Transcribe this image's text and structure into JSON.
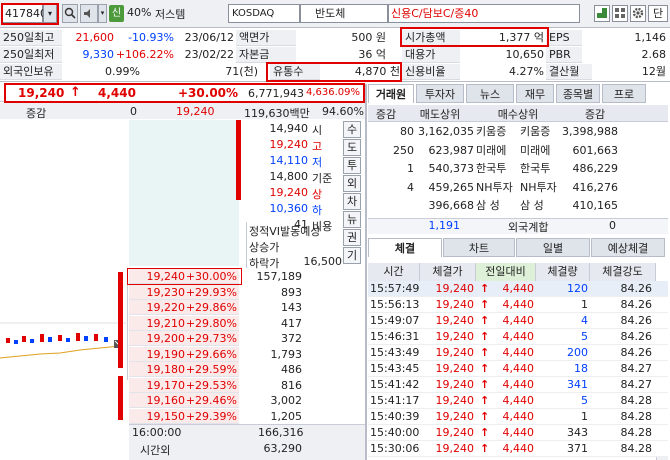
{
  "toolbar": {
    "code": "417840",
    "drop": "▾",
    "margin_rate": "40%",
    "stock_name": "저스템",
    "market": "KOSDAQ",
    "sector": "반도체",
    "tags": "신용C/담보C/증40",
    "credit_badge": "신",
    "btn_dan": "단"
  },
  "info": {
    "r1": {
      "l1": "250일최고",
      "v1": "21,600",
      "p1": "-10.93%",
      "d1": "23/06/12",
      "l2": "액면가",
      "v2": "500 원",
      "l3": "시가총액",
      "v3": "1,377 억",
      "l4": "EPS",
      "v4": "1,146"
    },
    "r2": {
      "l1": "250일최저",
      "v1": "9,330",
      "p1": "+106.22%",
      "d1": "23/02/22",
      "l2": "자본금",
      "v2": "36 억",
      "l3": "대용가",
      "v3": "10,650",
      "l4": "PBR",
      "v4": "2.68"
    },
    "r3": {
      "l1": "외국인보유",
      "v1": "0.99%",
      "v1b": "71(천)",
      "l3": "유통수",
      "v3": "4,870 천",
      "l4": "신용비율",
      "v4": "4.27%",
      "l5": "결산월",
      "v5": "12월"
    }
  },
  "price": {
    "current": "19,240",
    "arrow": "↑",
    "change": "4,440",
    "pct": "+30.00%",
    "volume": "6,771,943",
    "extra": "4,636.09%"
  },
  "chg": {
    "label": "증감",
    "v1": "0",
    "v2": "19,240",
    "v3": "119,630백만",
    "v4": "94.60%"
  },
  "summary": [
    {
      "price": "14,940",
      "label": "시"
    },
    {
      "price": "19,240",
      "label": "고"
    },
    {
      "price": "14,110",
      "label": "저"
    },
    {
      "price": "14,800",
      "label": "기준"
    },
    {
      "price": "19,240",
      "label": "상"
    },
    {
      "price": "10,360",
      "label": "하"
    },
    {
      "price": "41",
      "label": "비용"
    }
  ],
  "vi": {
    "line1": "정적VI발동예상",
    "line2": "상승가",
    "line3": "하락가",
    "val3": "16,500"
  },
  "side_buttons": [
    "수",
    "도",
    "투",
    "외",
    "차",
    "뉴",
    "권",
    "기"
  ],
  "orderbook": [
    {
      "price": "19,240",
      "pct": "+30.00%",
      "qty": "157,189"
    },
    {
      "price": "19,230",
      "pct": "+29.93%",
      "qty": "893"
    },
    {
      "price": "19,220",
      "pct": "+29.86%",
      "qty": "143"
    },
    {
      "price": "19,210",
      "pct": "+29.80%",
      "qty": "417"
    },
    {
      "price": "19,200",
      "pct": "+29.73%",
      "qty": "372"
    },
    {
      "price": "19,190",
      "pct": "+29.66%",
      "qty": "1,793"
    },
    {
      "price": "19,180",
      "pct": "+29.59%",
      "qty": "486"
    },
    {
      "price": "19,170",
      "pct": "+29.53%",
      "qty": "816"
    },
    {
      "price": "19,160",
      "pct": "+29.46%",
      "qty": "3,002"
    },
    {
      "price": "19,150",
      "pct": "+29.39%",
      "qty": "1,205"
    }
  ],
  "ob_footer": {
    "time": "16:00:00",
    "total": "166,316",
    "after_label": "시간외",
    "after_qty": "63,290"
  },
  "tabs": [
    "거래원",
    "투자자",
    "뉴스",
    "재무",
    "종목별",
    "프로"
  ],
  "broker": {
    "headers": [
      "증감",
      "매도상위",
      "매수상위",
      "증감"
    ],
    "rows": [
      {
        "chg": "80",
        "sell_qty": "3,162,035",
        "sell_name": "키움증",
        "buy_name": "키움증",
        "buy_qty": "3,398,988"
      },
      {
        "chg": "250",
        "sell_qty": "623,987",
        "sell_name": "미래에",
        "buy_name": "미래에",
        "buy_qty": "601,663"
      },
      {
        "chg": "1",
        "sell_qty": "540,373",
        "sell_name": "한국투",
        "buy_name": "한국투",
        "buy_qty": "486,229"
      },
      {
        "chg": "4",
        "sell_qty": "459,265",
        "sell_name": "NH투자",
        "buy_name": "NH투자",
        "buy_qty": "416,276"
      },
      {
        "chg": "",
        "sell_qty": "396,668",
        "sell_name": "삼 성",
        "buy_name": "삼 성",
        "buy_qty": "410,165"
      }
    ],
    "foreign": {
      "qty": "1,191",
      "label": "외국계합",
      "val": "0"
    }
  },
  "tabs2": [
    "체결",
    "차트",
    "일별",
    "예상체결"
  ],
  "trades_head": [
    "시간",
    "체결가",
    "전일대비",
    "체결량",
    "체결강도"
  ],
  "trades": [
    {
      "t": "15:57:49",
      "p": "19,240",
      "c": "4,440",
      "q": "120",
      "s": "84.26"
    },
    {
      "t": "15:56:13",
      "p": "19,240",
      "c": "4,440",
      "q": "1",
      "s": "84.26"
    },
    {
      "t": "15:49:07",
      "p": "19,240",
      "c": "4,440",
      "q": "4",
      "s": "84.26"
    },
    {
      "t": "15:46:31",
      "p": "19,240",
      "c": "4,440",
      "q": "5",
      "s": "84.26"
    },
    {
      "t": "15:43:49",
      "p": "19,240",
      "c": "4,440",
      "q": "200",
      "s": "84.26"
    },
    {
      "t": "15:43:45",
      "p": "19,240",
      "c": "4,440",
      "q": "18",
      "s": "84.27"
    },
    {
      "t": "15:41:42",
      "p": "19,240",
      "c": "4,440",
      "q": "341",
      "s": "84.27"
    },
    {
      "t": "15:41:17",
      "p": "19,240",
      "c": "4,440",
      "q": "5",
      "s": "84.28"
    },
    {
      "t": "15:40:39",
      "p": "19,240",
      "c": "4,440",
      "q": "1",
      "s": "84.28"
    },
    {
      "t": "15:40:00",
      "p": "19,240",
      "c": "4,440",
      "q": "343",
      "s": "84.28"
    },
    {
      "t": "15:30:06",
      "p": "19,240",
      "c": "4,440",
      "q": "371",
      "s": "84.28"
    }
  ],
  "colors": {
    "up": "#e00000",
    "down": "#0040ff",
    "panel": "#eef0f4"
  }
}
